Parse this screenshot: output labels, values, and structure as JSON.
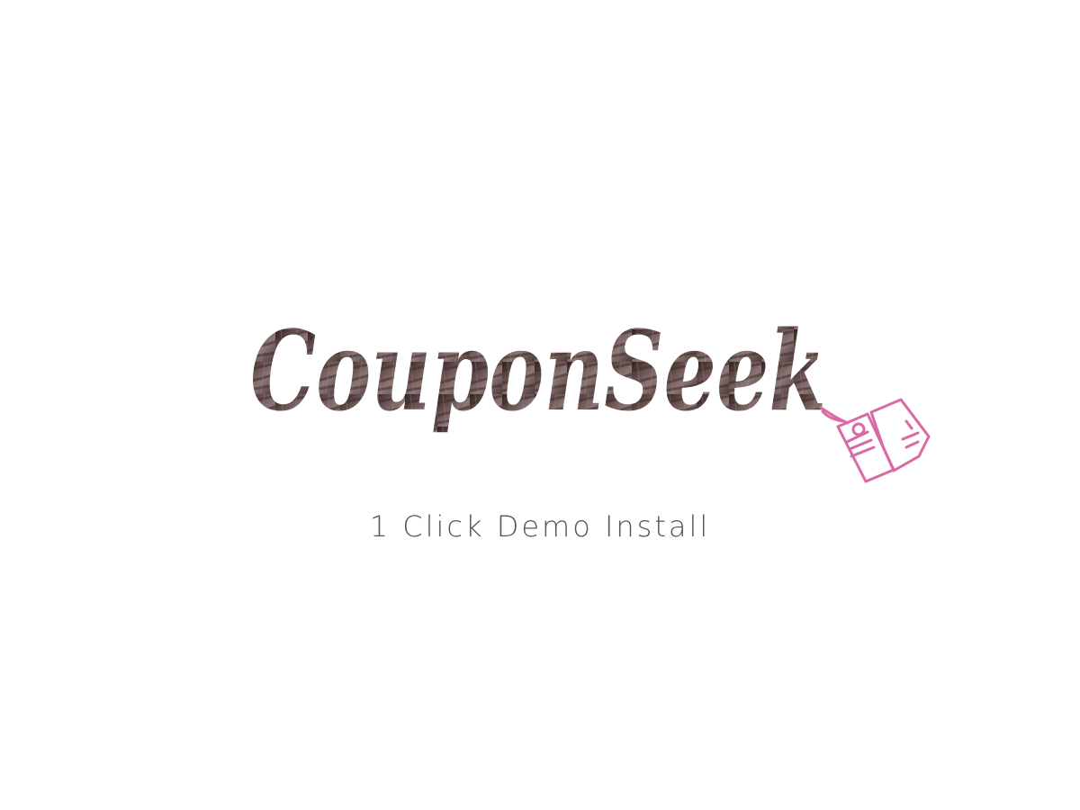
{
  "logo": {
    "text": "CouponSeek",
    "tag_icon": "price-tag-icon",
    "tag_color": "#d96aa5"
  },
  "subtitle": {
    "text": "1 Click Demo Install"
  }
}
